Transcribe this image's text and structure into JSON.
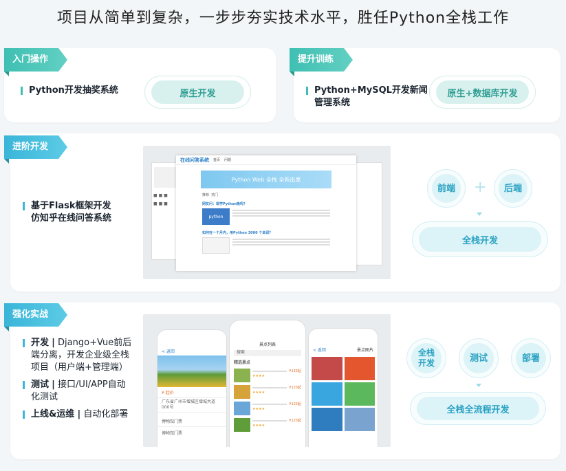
{
  "headline": "项目从简单到复杂，一步步夯实技术水平，胜任Python全栈工作",
  "sections": {
    "entry": {
      "tag": "入门操作",
      "item": "Python开发抽奖系统",
      "pill": "原生开发"
    },
    "upgrade": {
      "tag": "提升训练",
      "item_line1": "Python+MySQL开发新闻",
      "item_line2": "管理系统",
      "pill": "原生+数据库开发"
    },
    "advanced": {
      "tag": "进阶开发",
      "item_line1": "基于Flask框架开发",
      "item_line2": "仿知乎在线问答系统",
      "front": "前端",
      "back": "后端",
      "plus": "+",
      "fullstack": "全栈开发",
      "mock": {
        "site_title": "在线问答系统",
        "tab_home": "首页",
        "tab_q": "问题",
        "banner": "Python Web 全栈    全新出发",
        "filter1": "推荐",
        "filter2": "热门",
        "post1_title": "网友问：现学Python晚吗？",
        "post1_thumb": "python",
        "post2_title": "如何在一个月内，用Python 3000 个单词？"
      }
    },
    "strengthen": {
      "tag": "强化实战",
      "line1_bold": "开发",
      "line1_rest": "Django+Vue前后",
      "line2": "端分离，开发企业级全栈",
      "line3": "项目（用户端+管理端）",
      "line4_bold": "测试",
      "line4_rest": "接口/UI/APP自动",
      "line5": "化测试",
      "line6_bold": "上线&运维",
      "line6_rest": "自动化部署",
      "sep": "|",
      "c1": "全栈开发",
      "c2": "测试",
      "c3": "部署",
      "flow": "全栈全流程开发",
      "phone1": {
        "back": "< 返回",
        "price": "¥ 起价 ",
        "address": "广东省广州市增城区增城大道000号",
        "ticket1": "博物馆门票",
        "ticket2": "博物馆门票"
      },
      "phone2": {
        "title": "景点列表",
        "search": "搜索",
        "section": "精选景点",
        "price": "¥125起"
      },
      "phone3": {
        "title": "景点图片",
        "back": "< 返回"
      }
    }
  },
  "colors": {
    "teal": "#3fbfb3",
    "blue": "#3ab5d8",
    "pill_bg": "#d9f1ee",
    "circle_bg": "#dcf3f8"
  }
}
